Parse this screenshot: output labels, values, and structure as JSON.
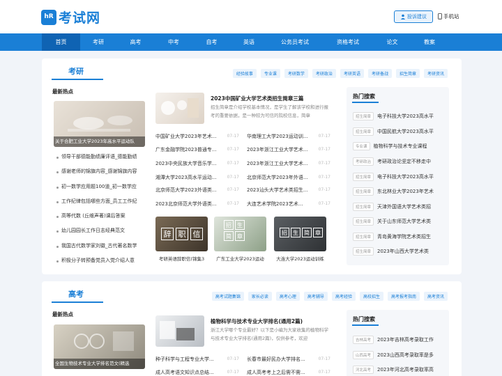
{
  "header": {
    "logo_mark": "hR",
    "logo_text": "考试网",
    "feedback_label": "投诉建议",
    "mobile_label": "手机站"
  },
  "nav": {
    "items": [
      "首页",
      "考研",
      "高考",
      "中考",
      "自考",
      "英语",
      "公务员考试",
      "资格考试",
      "论文",
      "教案"
    ],
    "active": "首页"
  },
  "sections": [
    {
      "title": "考研",
      "tags": [
        "经验故事",
        "专业课",
        "考研数学",
        "考研政治",
        "考研英语",
        "考研备战",
        "招生简章",
        "考研资讯"
      ],
      "latest_heading": "最新热点",
      "featured_caption": "关于合肥工业大学2023年高水平运动队",
      "headlines": [
        "领导干部德能勤绩廉评语_德能勤绩",
        "感谢老师的锦旗内容_感谢锦旗内容",
        "初一数学应用题100道_初一数学应",
        "工作纪律包括哪些方面_员工工作纪",
        "高等代数 (丘维声著)课后答案",
        "幼儿园园长工作日志经典范文",
        "我国古代数学家刘徽_古代著名数学",
        "积极分子转预备党员入党介绍人意"
      ],
      "article": {
        "title": "2023中国矿业大学艺术类招生简章三篇",
        "desc": "招生简章是介绍学校基本情况，是学生了解该学校和进行报考的重要依据，是一种较为可信的院校信息，简章"
      },
      "links_left": [
        {
          "title": "中国矿业大学2023年艺术...",
          "date": "07-17"
        },
        {
          "title": "广东金融学院2023普通专...",
          "date": "07-17"
        },
        {
          "title": "2023中央民族大学音乐学...",
          "date": "07-17"
        },
        {
          "title": "湘潭大学2023高水平运动...",
          "date": "07-17"
        },
        {
          "title": "北京师范大学2023外语类...",
          "date": "07-17"
        },
        {
          "title": "2023北京师范大学外语类...",
          "date": "07-17"
        }
      ],
      "links_right": [
        {
          "title": "华南理工大学2023运动训...",
          "date": "07-17"
        },
        {
          "title": "2023年浙江工业大学艺术...",
          "date": "07-17"
        },
        {
          "title": "2023年浙江工业大学艺术...",
          "date": "07-17"
        },
        {
          "title": "北京师范大学2023年外语...",
          "date": "07-17"
        },
        {
          "title": "2023汕头大学艺术类招生...",
          "date": "07-17"
        },
        {
          "title": "大连艺术学院2023艺术...",
          "date": "07-17"
        }
      ],
      "thumbs": [
        {
          "caption": "考研英语辞职信(锦集3",
          "stamps": [
            "辞",
            "职",
            "信"
          ]
        },
        {
          "caption": "广东工业大学2023运动",
          "stamps": [
            "招",
            "生",
            "简",
            "章"
          ]
        },
        {
          "caption": "大连大学2023运动训练",
          "stamps": [
            "招",
            "生",
            "简",
            "章"
          ]
        }
      ],
      "hot": {
        "heading": "热门搜索",
        "items": [
          {
            "tag": "招生简章",
            "title": "电子科技大学2023高水平"
          },
          {
            "tag": "招生简章",
            "title": "中国民航大学2023高水平"
          },
          {
            "tag": "专业课",
            "title": "植物科学与技术专业课程"
          },
          {
            "tag": "考研政治",
            "title": "考研政治论坚定不移走中"
          },
          {
            "tag": "招生简章",
            "title": "电子科技大学2023高水平"
          },
          {
            "tag": "招生简章",
            "title": "东北林业大学2023年艺术"
          },
          {
            "tag": "招生简章",
            "title": "天津外国语大学艺术类招"
          },
          {
            "tag": "招生简章",
            "title": "关于山东师范大学艺术类"
          },
          {
            "tag": "招生简章",
            "title": "青岛黄海学院艺术类招生"
          },
          {
            "tag": "招生简章",
            "title": "2023年山西大学艺术类"
          }
        ]
      }
    },
    {
      "title": "高考",
      "tags": [
        "高考试题集锦",
        "家长必读",
        "高考心理",
        "高考辅导",
        "高考经验",
        "高校招生",
        "高考报考指南",
        "高考资讯"
      ],
      "latest_heading": "最新热点",
      "featured_caption": "全国生物技术专业大学排名范文(精选",
      "article": {
        "title": "植物科学与技术专业大学排名(通用2篇)",
        "desc": "浙江大学哪个专业最好？以下是小编为大家收集的植物科学与技术专业大学排名(通用2篇)，仅供参考，欢迎"
      },
      "links_left": [
        {
          "title": "种子科学与工程专业大学...",
          "date": "07-17"
        },
        {
          "title": "成人高考语文知识点总结...",
          "date": "07-17"
        }
      ],
      "links_right": [
        {
          "title": "长春市最好民办大学排名...",
          "date": "07-17"
        },
        {
          "title": "成人高考考上之后需不需...",
          "date": "07-17"
        }
      ],
      "hot": {
        "heading": "热门搜索",
        "items": [
          {
            "tag": "吉林高考",
            "title": "2023年吉林高考录取工作"
          },
          {
            "tag": "山西高考",
            "title": "2023山西高考录取率是多"
          },
          {
            "tag": "河北高考",
            "title": "2023年河北高考录取率高"
          }
        ]
      }
    }
  ],
  "colors": {
    "brand": "#1a7fd6",
    "nav_active": "#0f63b3",
    "background": "#f1f4f9"
  }
}
